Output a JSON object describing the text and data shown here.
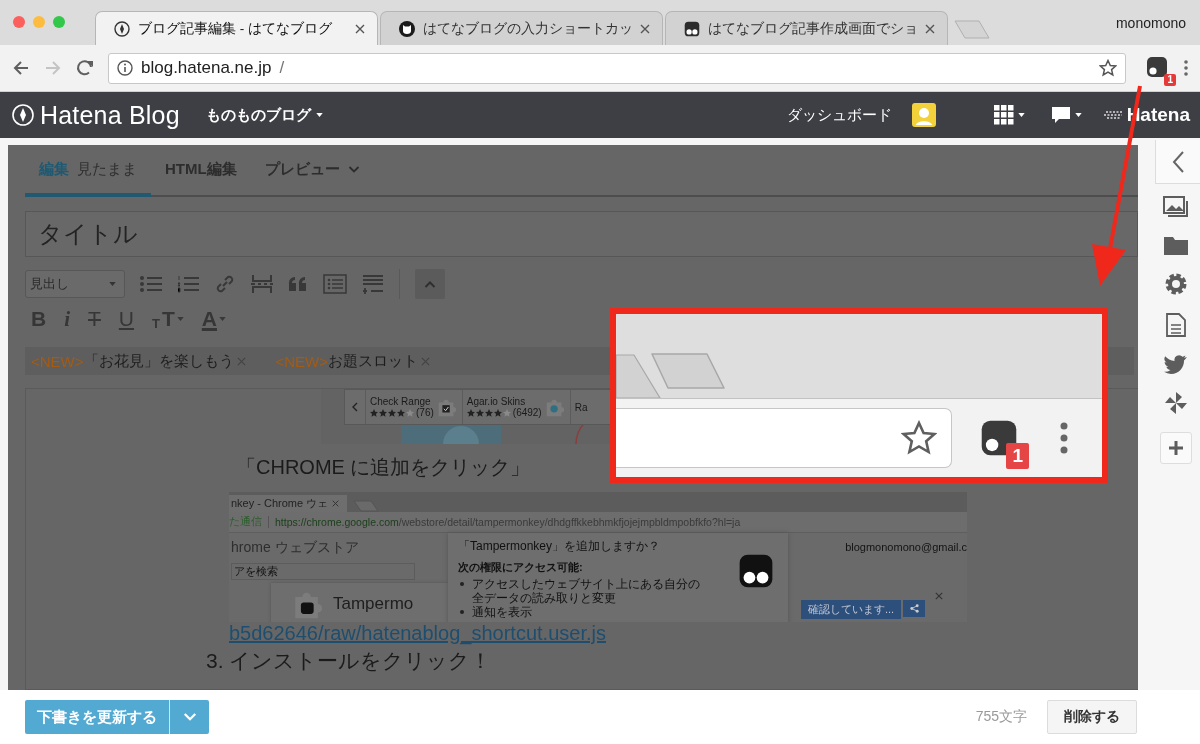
{
  "browser": {
    "tabs": [
      {
        "title": "ブログ記事編集 - はてなブログ",
        "selected": true
      },
      {
        "title": "はてなブログの入力ショートカッ",
        "selected": false
      },
      {
        "title": "はてなブログ記事作成画面でショ",
        "selected": false
      }
    ],
    "profile": "monomono",
    "url": {
      "host": "blog.hatena.ne.jp",
      "path": "/"
    },
    "extension_badge": "1"
  },
  "header": {
    "logo": "Hatena Blog",
    "blog_name": "ものものブログ",
    "dashboard": "ダッシュボード",
    "brand": "Hatena"
  },
  "editor": {
    "tabs": [
      {
        "label": "編集",
        "sublabel": "見たまま",
        "selected": true
      },
      {
        "label": "HTML編集",
        "selected": false
      },
      {
        "label": "プレビュー",
        "selected": false
      }
    ],
    "title_placeholder": "タイトル",
    "heading_select": "見出し",
    "format_buttons": [
      {
        "label": "B",
        "kind": "bold"
      },
      {
        "label": "i",
        "kind": "italic"
      },
      {
        "label": "T",
        "kind": "strike"
      },
      {
        "label": "U",
        "kind": "underline"
      },
      {
        "label": "TT",
        "kind": "size"
      },
      {
        "label": "A",
        "kind": "color"
      }
    ],
    "notices": [
      {
        "tag": "<NEW>",
        "text": "「お花見」を楽しもう"
      },
      {
        "tag": "<NEW>",
        "text": "お題スロット"
      }
    ],
    "content": {
      "store_items": [
        {
          "name": "Check Range",
          "stars": 4,
          "count": "(76)"
        },
        {
          "name": "Agar.io Skins",
          "stars": 4,
          "count": "(6492)"
        },
        {
          "name": "Ra"
        }
      ],
      "caption": "「CHROME に追加をクリック」",
      "screenshot": {
        "tab": "nkey - Chrome ウェ",
        "secure_label": "た通信",
        "url_host": "https://chrome.google.com",
        "url_path": "/webstore/detail/tampermonkey/dhdgffkkebhmkfjojejmpbldmpobfkfo?hl=ja",
        "store_title": "hrome ウェブストア",
        "search_placeholder": "アを検索",
        "account": "blogmonomono@gmail.c",
        "dialog_title": "「Tampermonkey」を追加しますか？",
        "permissions_heading": "次の権限にアクセス可能:",
        "permissions": [
          "アクセスしたウェブサイト上にある自分の全データの読み取りと変更",
          "通知を表示"
        ],
        "extension_name": "Tampermo",
        "button": "確認しています..."
      },
      "link": "b5d62646/raw/hatenablog_shortcut.user.js",
      "step": "3. インストールをクリック！"
    }
  },
  "callout": {
    "badge": "1"
  },
  "footer": {
    "save": "下書きを更新する",
    "char_count": "755文字",
    "delete": "削除する"
  }
}
